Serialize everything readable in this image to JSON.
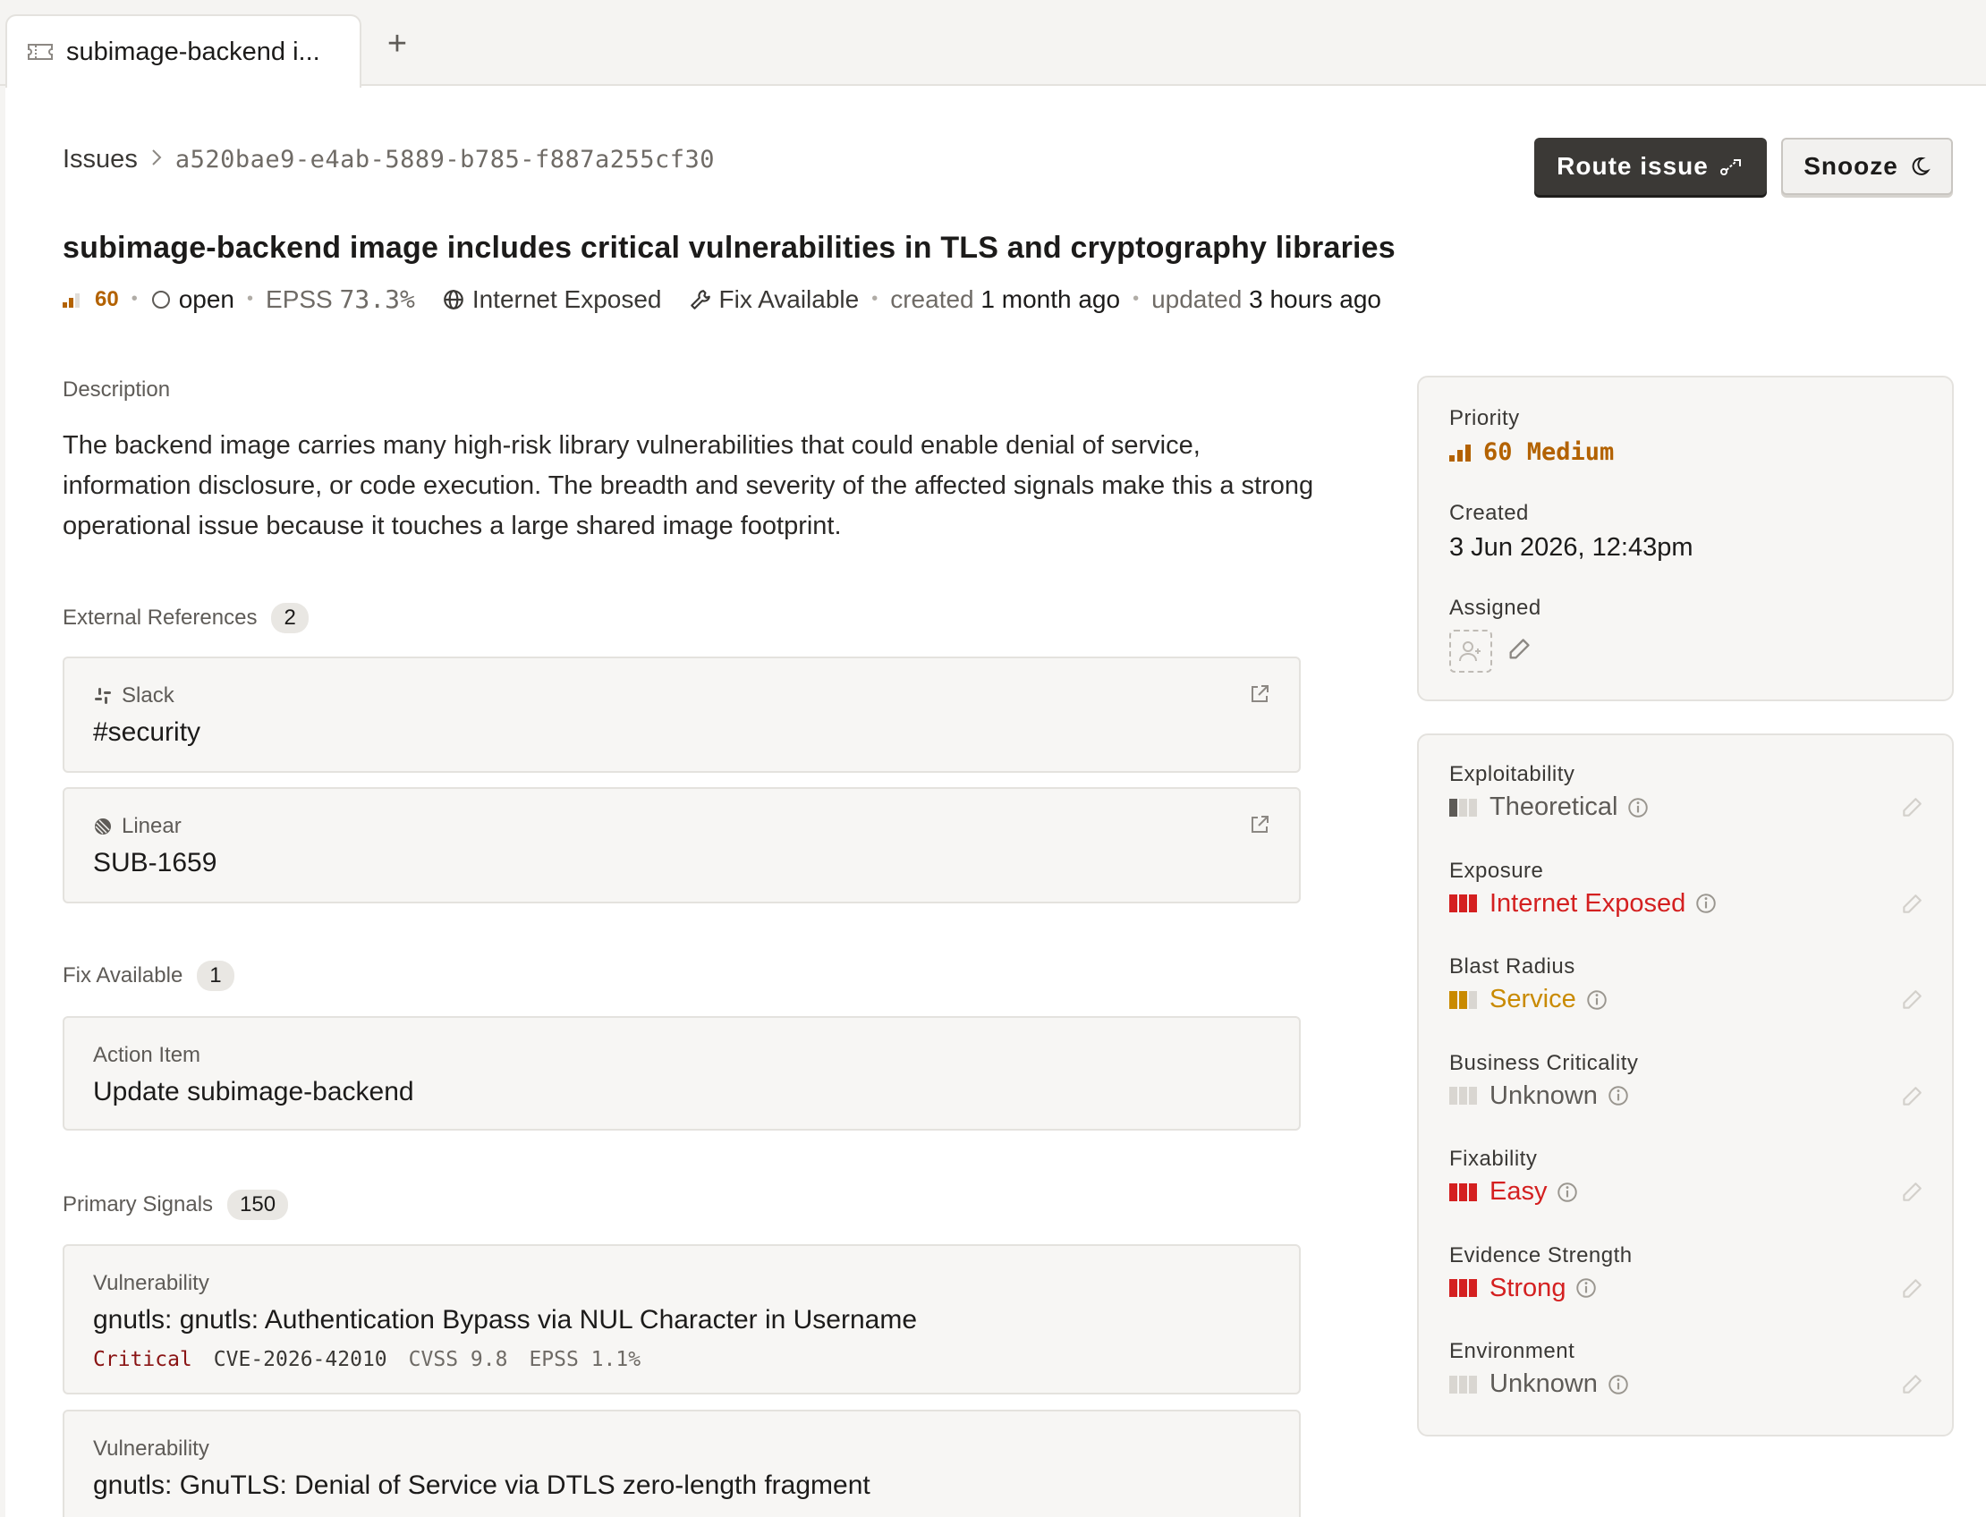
{
  "tab": {
    "label": "subimage-backend i...",
    "icon": "ticket-icon"
  },
  "tab_add": {
    "label": "+"
  },
  "breadcrumb": {
    "root": "Issues",
    "separator": ">",
    "id": "a520bae9-e4ab-5889-b785-f887a255cf30"
  },
  "actions": {
    "route_label": "Route issue",
    "snooze_label": "Snooze"
  },
  "issue": {
    "title": "subimage-backend image includes critical vulnerabilities in TLS and cryptography libraries",
    "priority_score": "60",
    "status": "open",
    "epss_label": "EPSS",
    "epss_value": "73.3%",
    "exposure": "Internet Exposed",
    "fix": "Fix Available",
    "created_label": "created",
    "created_value": "1 month ago",
    "updated_label": "updated",
    "updated_value": "3 hours ago"
  },
  "description": {
    "label": "Description",
    "text": "The backend image carries many high-risk library vulnerabilities that could enable denial of service, information disclosure, or code execution. The breadth and severity of the affected signals make this a strong operational issue because it touches a large shared image footprint."
  },
  "external_refs": {
    "label": "External References",
    "count": "2",
    "items": [
      {
        "source": "Slack",
        "value": "#security"
      },
      {
        "source": "Linear",
        "value": "SUB-1659"
      }
    ]
  },
  "fix_available": {
    "label": "Fix Available",
    "count": "1",
    "items": [
      {
        "type": "Action Item",
        "value": "Update subimage-backend"
      }
    ]
  },
  "primary_signals": {
    "label": "Primary Signals",
    "count": "150",
    "items": [
      {
        "type": "Vulnerability",
        "title": "gnutls: gnutls: Authentication Bypass via NUL Character in Username",
        "severity": "Critical",
        "cve": "CVE-2026-42010",
        "cvss": "CVSS 9.8",
        "epss": "EPSS 1.1%"
      },
      {
        "type": "Vulnerability",
        "title": "gnutls: GnuTLS: Denial of Service via DTLS zero-length fragment"
      }
    ]
  },
  "details": {
    "priority_label": "Priority",
    "priority_value": "60 Medium",
    "created_label": "Created",
    "created_value": "3 Jun 2026, 12:43pm",
    "assigned_label": "Assigned"
  },
  "factors": [
    {
      "label": "Exploitability",
      "value": "Theoretical",
      "level": 1,
      "color": "#5e5b57"
    },
    {
      "label": "Exposure",
      "value": "Internet Exposed",
      "level": 3,
      "color": "#d42020"
    },
    {
      "label": "Blast Radius",
      "value": "Service",
      "level": 2,
      "color": "#c98a00"
    },
    {
      "label": "Business Criticality",
      "value": "Unknown",
      "level": 0,
      "color": "#5e5b57"
    },
    {
      "label": "Fixability",
      "value": "Easy",
      "level": 3,
      "color": "#d42020"
    },
    {
      "label": "Evidence Strength",
      "value": "Strong",
      "level": 3,
      "color": "#d42020"
    },
    {
      "label": "Environment",
      "value": "Unknown",
      "level": 0,
      "color": "#5e5b57"
    }
  ],
  "colors": {
    "accent_orange": "#b36200",
    "danger": "#d42020",
    "warning": "#c98a00",
    "dark_button": "#3b3936"
  }
}
